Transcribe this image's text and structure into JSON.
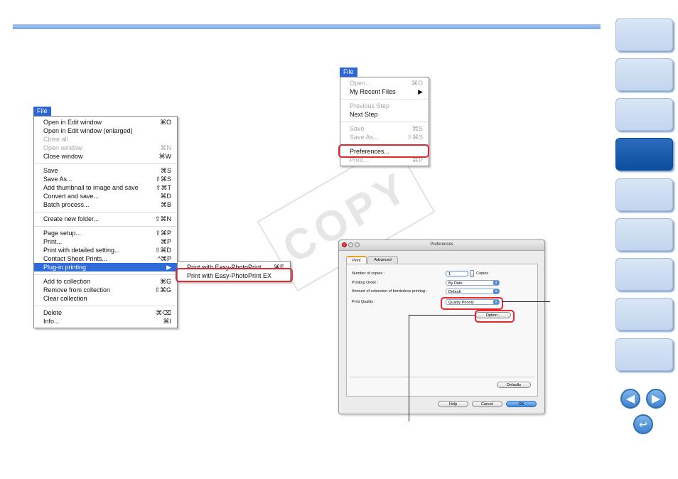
{
  "left_menu": {
    "title": "File",
    "groups": [
      [
        {
          "label": "Open in Edit window",
          "shortcut": "⌘O",
          "disabled": false
        },
        {
          "label": "Open in Edit window (enlarged)",
          "shortcut": "",
          "disabled": false
        },
        {
          "label": "Close all",
          "shortcut": "",
          "disabled": true
        },
        {
          "label": "Open window",
          "shortcut": "⌘N",
          "disabled": true
        },
        {
          "label": "Close window",
          "shortcut": "⌘W",
          "disabled": false
        }
      ],
      [
        {
          "label": "Save",
          "shortcut": "⌘S",
          "disabled": false
        },
        {
          "label": "Save As...",
          "shortcut": "⇧⌘S",
          "disabled": false
        },
        {
          "label": "Add thumbnail to image and save",
          "shortcut": "⇧⌘T",
          "disabled": false
        },
        {
          "label": "Convert and save...",
          "shortcut": "⌘D",
          "disabled": false
        },
        {
          "label": "Batch process...",
          "shortcut": "⌘B",
          "disabled": false
        }
      ],
      [
        {
          "label": "Create new folder...",
          "shortcut": "⇧⌘N",
          "disabled": false
        }
      ],
      [
        {
          "label": "Page setup...",
          "shortcut": "⇧⌘P",
          "disabled": false
        },
        {
          "label": "Print...",
          "shortcut": "⌘P",
          "disabled": false
        },
        {
          "label": "Print with detailed setting...",
          "shortcut": "⇧⌘D",
          "disabled": false
        },
        {
          "label": "Contact Sheet Prints...",
          "shortcut": "^⌘P",
          "disabled": false
        },
        {
          "label": "Plug-in printing",
          "shortcut": "▶",
          "disabled": false,
          "highlighted": true
        }
      ],
      [
        {
          "label": "Add to collection",
          "shortcut": "⌘G",
          "disabled": false
        },
        {
          "label": "Remove from collection",
          "shortcut": "⇧⌘G",
          "disabled": false
        },
        {
          "label": "Clear collection",
          "shortcut": "",
          "disabled": false
        }
      ],
      [
        {
          "label": "Delete",
          "shortcut": "⌘⌫",
          "disabled": false
        },
        {
          "label": "Info...",
          "shortcut": "⌘I",
          "disabled": false
        }
      ]
    ],
    "submenu": [
      {
        "label": "Print with Easy-PhotoPrint",
        "shortcut": "⌘E"
      },
      {
        "label": "Print with Easy-PhotoPrint EX",
        "shortcut": ""
      }
    ]
  },
  "right_menu": {
    "title": "File",
    "groups": [
      [
        {
          "label": "Open...",
          "shortcut": "⌘O",
          "disabled": true
        },
        {
          "label": "My Recent Files",
          "shortcut": "▶",
          "disabled": false
        }
      ],
      [
        {
          "label": "Previous Step",
          "shortcut": "",
          "disabled": true
        },
        {
          "label": "Next Step",
          "shortcut": "",
          "disabled": false
        }
      ],
      [
        {
          "label": "Save",
          "shortcut": "⌘S",
          "disabled": true
        },
        {
          "label": "Save As...",
          "shortcut": "⇧⌘S",
          "disabled": true
        }
      ],
      [
        {
          "label": "Preferences...",
          "shortcut": "",
          "disabled": false
        },
        {
          "label": "Print...",
          "shortcut": "⌘P",
          "disabled": true
        }
      ]
    ]
  },
  "preferences": {
    "title": "Preferences",
    "tabs": [
      "Print",
      "Advanced"
    ],
    "copies_label": "Number of copies :",
    "copies_value": "1",
    "copies_unit": "Copies",
    "order_label": "Printing Order :",
    "order_value": "By Date",
    "extension_label": "Amount of extension of borderless printing :",
    "extension_value": "Default",
    "quality_label": "Print Quality :",
    "quality_value": "Quality Priority",
    "option_button": "Option...",
    "defaults_button": "Defaults",
    "help_button": "Help",
    "cancel_button": "Cancel",
    "ok_button": "OK"
  },
  "watermark": "COPY",
  "colors": {
    "accent": "#2b67d8",
    "highlight_box": "#e3262f",
    "nav_active": "#0c4e9e"
  }
}
